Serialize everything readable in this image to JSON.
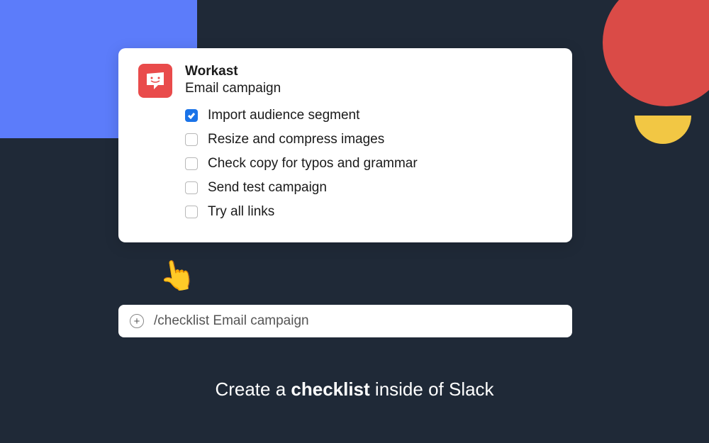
{
  "app": {
    "name": "Workast",
    "list_title": "Email campaign"
  },
  "items": [
    {
      "label": "Import audience segment",
      "checked": true
    },
    {
      "label": "Resize and compress images",
      "checked": false
    },
    {
      "label": "Check copy for typos and grammar",
      "checked": false
    },
    {
      "label": "Send test campaign",
      "checked": false
    },
    {
      "label": "Try all links",
      "checked": false
    }
  ],
  "input": {
    "command": "/checklist Email campaign"
  },
  "caption": {
    "prefix": "Create a ",
    "bold": "checklist",
    "suffix": " inside of Slack"
  },
  "colors": {
    "bg": "#1f2937",
    "accent_blue": "#5c7cfa",
    "accent_red": "#da4b47",
    "accent_yellow": "#f2c744",
    "checkbox_checked": "#1a73e8",
    "app_icon_bg": "#e94b4b"
  }
}
